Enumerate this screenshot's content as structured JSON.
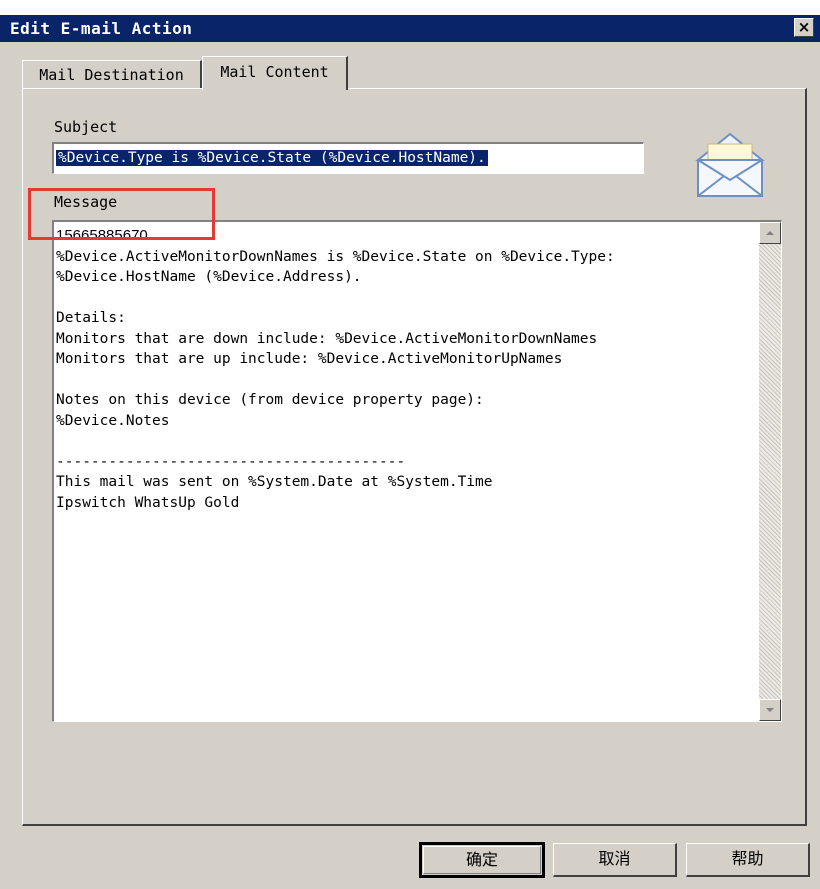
{
  "window": {
    "title": "Edit E-mail Action",
    "close_label": "×"
  },
  "tabs": [
    {
      "label": "Mail Destination",
      "active": false
    },
    {
      "label": "Mail Content",
      "active": true
    }
  ],
  "subject": {
    "label": "Subject",
    "value": "%Device.Type is %Device.State (%Device.HostName)."
  },
  "message": {
    "label": "Message",
    "first_line": "15665885670",
    "body": "%Device.ActiveMonitorDownNames is %Device.State on %Device.Type:\n%Device.HostName (%Device.Address).\n\nDetails:\nMonitors that are down include: %Device.ActiveMonitorDownNames\nMonitors that are up include: %Device.ActiveMonitorUpNames\n\nNotes on this device (from device property page):\n%Device.Notes\n\n----------------------------------------\nThis mail was sent on %System.Date at %System.Time\nIpswitch WhatsUp Gold"
  },
  "buttons": {
    "ok": "确定",
    "cancel": "取消",
    "help": "帮助"
  },
  "colors": {
    "titlebar": "#0a246a",
    "highlight": "#e53935",
    "face": "#d4d0c8"
  }
}
